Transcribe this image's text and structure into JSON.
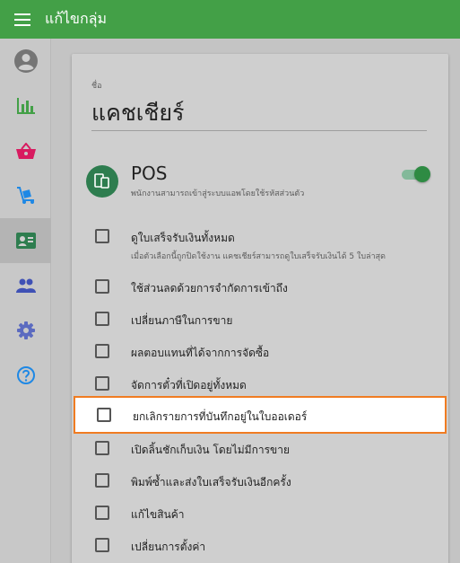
{
  "header": {
    "title": "แก้ไขกลุ่ม",
    "menu_icon": "hamburger-menu-icon"
  },
  "sidebar": {
    "items": [
      {
        "icon": "account-circle-icon",
        "active": false
      },
      {
        "icon": "bar-chart-icon",
        "active": false
      },
      {
        "icon": "shopping-basket-icon",
        "active": false
      },
      {
        "icon": "dolly-icon",
        "active": false
      },
      {
        "icon": "badge-card-icon",
        "active": true
      },
      {
        "icon": "people-icon",
        "active": false
      },
      {
        "icon": "gear-icon",
        "active": false
      },
      {
        "icon": "help-icon",
        "active": false
      }
    ]
  },
  "form": {
    "name_label": "ชื่อ",
    "name_value": "แคชเชียร์"
  },
  "pos": {
    "title": "POS",
    "description": "พนักงานสามารถเข้าสู่ระบบแอพโดยใช้รหัสส่วนตัว",
    "enabled": true
  },
  "permissions": [
    {
      "label": "ดูใบเสร็จรับเงินทั้งหมด",
      "sublabel": "เมื่อตัวเลือกนี้ถูกปิดใช้งาน แคชเชียร์สามารถดูใบเสร็จรับเงินได้ 5 ใบล่าสุด",
      "checked": false
    },
    {
      "label": "ใช้ส่วนลดด้วยการจำกัดการเข้าถึง",
      "checked": false
    },
    {
      "label": "เปลี่ยนภาษีในการขาย",
      "checked": false
    },
    {
      "label": "ผลตอบแทนที่ได้จากการจัดซื้อ",
      "checked": false
    },
    {
      "label": "จัดการตั๋วที่เปิดอยู่ทั้งหมด",
      "checked": false
    },
    {
      "label": "ยกเลิกรายการที่บันทึกอยู่ในใบออเดอร์",
      "checked": false
    },
    {
      "label": "เปิดลิ้นชักเก็บเงิน โดยไม่มีการขาย",
      "checked": false
    },
    {
      "label": "พิมพ์ซ้ำและส่งใบเสร็จรับเงินอีกครั้ง",
      "checked": false
    },
    {
      "label": "แก้ไขสินค้า",
      "checked": false
    },
    {
      "label": "เปลี่ยนการตั้งค่า",
      "checked": false
    }
  ],
  "colors": {
    "topbar": "#43a047",
    "highlight_border": "#f07c22",
    "pos_icon_bg": "#2e7d4f",
    "toggle_on": "#2e8b43"
  }
}
